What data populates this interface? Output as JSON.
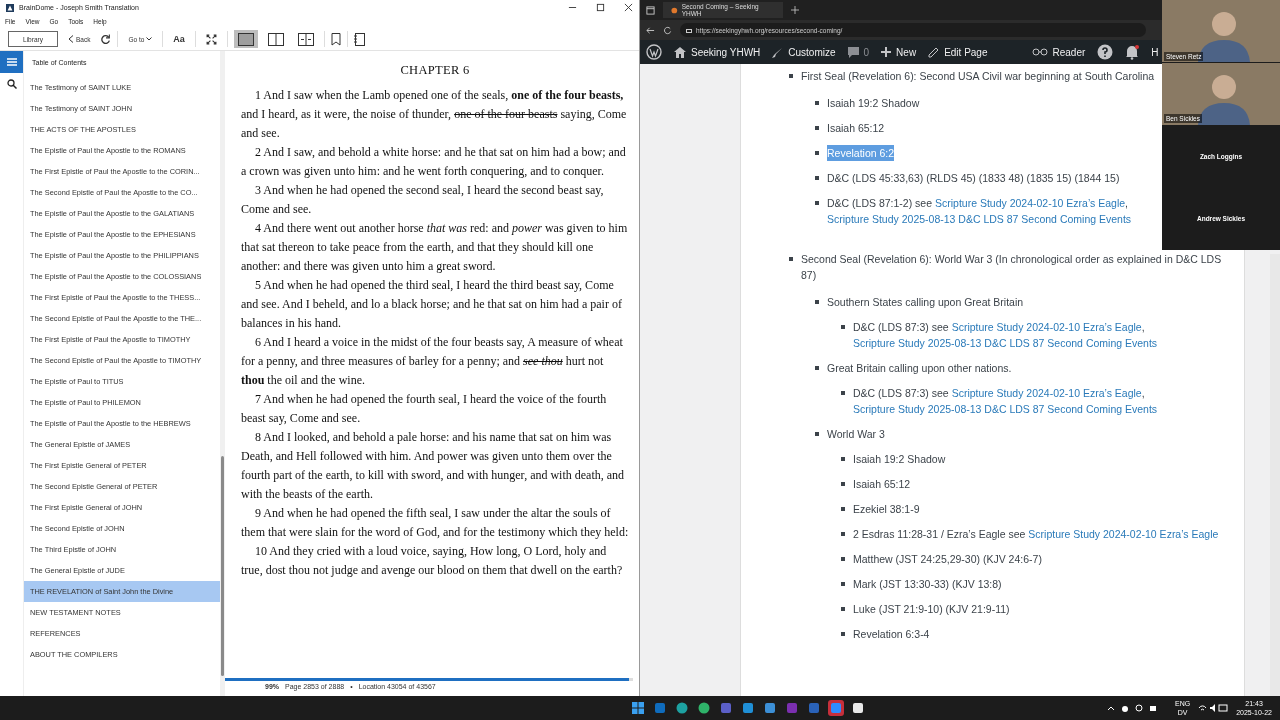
{
  "reader": {
    "window": {
      "title": "BrainDome - Joseph Smith Translation"
    },
    "menu": [
      "File",
      "View",
      "Go",
      "Tools",
      "Help"
    ],
    "toolbar": {
      "library": "Library",
      "back": "Back",
      "goto": "Go to",
      "font": "Aa",
      "views": [
        {
          "kind": "single",
          "selected": true
        },
        {
          "kind": "double",
          "selected": false
        },
        {
          "kind": "spread",
          "selected": false
        }
      ]
    },
    "sidebar": {
      "tabs": [
        {
          "kind": "toc",
          "selected": true
        },
        {
          "kind": "search",
          "selected": false
        }
      ],
      "title": "Table of Contents",
      "items": [
        {
          "label": "The Testimony of SAINT LUKE",
          "selected": false
        },
        {
          "label": "The Testimony of SAINT JOHN",
          "selected": false
        },
        {
          "label": "THE ACTS OF THE APOSTLES",
          "selected": false
        },
        {
          "label": "The Epistle of Paul the Apostle to the ROMANS",
          "selected": false
        },
        {
          "label": "The First Epistle of Paul the Apostle to the CORIN...",
          "selected": false
        },
        {
          "label": "The Second Epistle of Paul the Apostle to the CO...",
          "selected": false
        },
        {
          "label": "The Epistle of Paul the Apostle to the GALATIANS",
          "selected": false
        },
        {
          "label": "The Epistle of Paul the Apostle to the EPHESIANS",
          "selected": false
        },
        {
          "label": "The Epistle of Paul the Apostle to the PHILIPPIANS",
          "selected": false
        },
        {
          "label": "The Epistle of Paul the Apostle to the COLOSSIANS",
          "selected": false
        },
        {
          "label": "The First Epistle of Paul the Apostle to the THESS...",
          "selected": false
        },
        {
          "label": "The Second Epistle of Paul the Apostle to the THE...",
          "selected": false
        },
        {
          "label": "The First Epistle of Paul the Apostle to TIMOTHY",
          "selected": false
        },
        {
          "label": "The Second Epistle of Paul the Apostle to TIMOTHY",
          "selected": false
        },
        {
          "label": "The Epistle of Paul to TITUS",
          "selected": false
        },
        {
          "label": "The Epistle of Paul to PHILEMON",
          "selected": false
        },
        {
          "label": "The Epistle of Paul the Apostle to the HEBREWS",
          "selected": false
        },
        {
          "label": "The General Epistle of JAMES",
          "selected": false
        },
        {
          "label": "The First Epistle General of PETER",
          "selected": false
        },
        {
          "label": "The Second Epistle General of PETER",
          "selected": false
        },
        {
          "label": "The First Epistle General of JOHN",
          "selected": false
        },
        {
          "label": "The Second Epistle of JOHN",
          "selected": false
        },
        {
          "label": "The Third Epistle of JOHN",
          "selected": false
        },
        {
          "label": "The General Epistle of JUDE",
          "selected": false
        },
        {
          "label": "THE REVELATION of Saint John the Divine",
          "selected": true
        },
        {
          "label": "NEW TESTAMENT NOTES",
          "selected": false
        },
        {
          "label": "REFERENCES",
          "selected": false
        },
        {
          "label": "ABOUT THE COMPILERS",
          "selected": false
        }
      ]
    },
    "chapter": {
      "title": "CHAPTER 6",
      "verses": [
        [
          {
            "kind": "plain",
            "text": "1 And I saw when the Lamb opened one of the seals, "
          },
          {
            "kind": "bold",
            "text": "one of the four beasts,"
          },
          {
            "kind": "plain",
            "text": " and I heard, as it were, the noise of thunder, "
          },
          {
            "kind": "struck",
            "text": "one of the four beasts"
          },
          {
            "kind": "plain",
            "text": " saying, Come and see."
          }
        ],
        [
          {
            "kind": "plain",
            "text": "2 And I saw, and behold a white horse: and he that sat on him had a bow; and a crown was given unto him: and he went forth conquering, and to conquer."
          }
        ],
        [
          {
            "kind": "plain",
            "text": "3 And when he had opened the second seal, I heard the second beast say, Come and see."
          }
        ],
        [
          {
            "kind": "plain",
            "text": "4 And there went out another horse "
          },
          {
            "kind": "italic",
            "text": "that was"
          },
          {
            "kind": "plain",
            "text": " red: and "
          },
          {
            "kind": "italic",
            "text": "power"
          },
          {
            "kind": "plain",
            "text": " was given to him that sat thereon to take peace from the earth, and that they should kill one another: and there was given unto him a great sword."
          }
        ],
        [
          {
            "kind": "plain",
            "text": "5 And when he had opened the third seal, I heard the third beast say, Come and see. And I beheld, and lo a black horse; and he that sat on him had a pair of balances in his hand."
          }
        ],
        [
          {
            "kind": "plain",
            "text": "6 And I heard a voice in the midst of the four beasts say, A measure of wheat for a penny, and three measures of barley for a penny; and "
          },
          {
            "kind": "struck_italic",
            "text": "see thou"
          },
          {
            "kind": "plain",
            "text": " hurt not "
          },
          {
            "kind": "bold",
            "text": "thou"
          },
          {
            "kind": "plain",
            "text": " the oil and the wine."
          }
        ],
        [
          {
            "kind": "plain",
            "text": "7 And when he had opened the fourth seal, I heard the voice of the fourth beast say, Come and see."
          }
        ],
        [
          {
            "kind": "plain",
            "text": "8 And I looked, and behold a pale horse: and his name that sat on him was Death, and Hell followed with him. And power was given unto them over the fourth part of the earth, to kill with sword, and with hunger, and with death, and with the beasts of the earth."
          }
        ],
        [
          {
            "kind": "plain",
            "text": "9 And when he had opened the fifth seal, I saw under the altar the souls of them that were slain for the word of God, and for the testimony which they held:"
          }
        ],
        [
          {
            "kind": "plain",
            "text": "10 And they cried with a loud voice, saying, How long, O Lord, holy and true, dost thou not judge and avenge our blood on them that dwell on the earth?"
          }
        ]
      ]
    },
    "status": {
      "percent": "99%",
      "page": "Page 2853 of 2888",
      "separator": "•",
      "location": "Location 43054 of 43567",
      "level": 0.99
    }
  },
  "browser": {
    "tab": "Second Coming – Seeking YHWH",
    "url": "https://seekingyhwh.org/resources/second-coming/",
    "admin_bar": {
      "site": "Seeking YHWH",
      "customize": "Customize",
      "comments": "0",
      "new": "New",
      "edit": "Edit Page",
      "reader": "Reader",
      "cut_item": "H"
    },
    "outline": [
      {
        "highlighted": false,
        "segments": [
          {
            "kind": "text",
            "text": "First Seal (Revelation 6): Second USA Civil war beginning at South Carolina"
          }
        ],
        "children": [
          {
            "highlighted": false,
            "segments": [
              {
                "kind": "text",
                "text": "Isaiah 19:2 Shadow"
              }
            ]
          },
          {
            "highlighted": false,
            "segments": [
              {
                "kind": "text",
                "text": "Isaiah 65:12"
              }
            ]
          },
          {
            "highlighted": true,
            "segments": [
              {
                "kind": "text",
                "text": "Revelation 6:2"
              }
            ]
          },
          {
            "highlighted": false,
            "segments": [
              {
                "kind": "text",
                "text": "D&C (LDS 45:33,63) (RLDS 45) (1833 48) (1835 15) (1844 15)"
              }
            ]
          },
          {
            "highlighted": false,
            "segments": [
              {
                "kind": "text",
                "text": "D&C (LDS 87:1-2) see "
              },
              {
                "kind": "link",
                "text": "Scripture Study 2024-02-10 Ezra’s Eagle"
              },
              {
                "kind": "text",
                "text": ", "
              },
              {
                "kind": "link",
                "text": "Scripture Study 2025-08-13 D&C LDS 87 Second Coming Events"
              }
            ]
          }
        ]
      },
      {
        "highlighted": false,
        "segments": [
          {
            "kind": "text",
            "text": "Second Seal (Revelation 6): World War 3 (In chronological order as explained in D&C LDS 87)"
          }
        ],
        "children": [
          {
            "highlighted": false,
            "segments": [
              {
                "kind": "text",
                "text": "Southern States calling upon Great Britain"
              }
            ],
            "children": [
              {
                "highlighted": false,
                "segments": [
                  {
                    "kind": "text",
                    "text": "D&C (LDS 87:3) see "
                  },
                  {
                    "kind": "link",
                    "text": "Scripture Study 2024-02-10 Ezra’s Eagle"
                  },
                  {
                    "kind": "text",
                    "text": ", "
                  },
                  {
                    "kind": "link",
                    "text": "Scripture Study 2025-08-13 D&C LDS 87 Second Coming Events"
                  }
                ]
              }
            ]
          },
          {
            "highlighted": false,
            "segments": [
              {
                "kind": "text",
                "text": "Great Britain calling upon other nations."
              }
            ],
            "children": [
              {
                "highlighted": false,
                "segments": [
                  {
                    "kind": "text",
                    "text": "D&C (LDS 87:3) see "
                  },
                  {
                    "kind": "link",
                    "text": "Scripture Study 2024-02-10 Ezra’s Eagle"
                  },
                  {
                    "kind": "text",
                    "text": ", "
                  },
                  {
                    "kind": "link",
                    "text": "Scripture Study 2025-08-13 D&C LDS 87 Second Coming Events"
                  }
                ]
              }
            ]
          },
          {
            "highlighted": false,
            "segments": [
              {
                "kind": "text",
                "text": "World War 3"
              }
            ],
            "children": [
              {
                "highlighted": false,
                "segments": [
                  {
                    "kind": "text",
                    "text": "Isaiah 19:2 Shadow"
                  }
                ]
              },
              {
                "highlighted": false,
                "segments": [
                  {
                    "kind": "text",
                    "text": "Isaiah 65:12"
                  }
                ]
              },
              {
                "highlighted": false,
                "segments": [
                  {
                    "kind": "text",
                    "text": "Ezekiel 38:1-9"
                  }
                ]
              },
              {
                "highlighted": false,
                "segments": [
                  {
                    "kind": "text",
                    "text": "2 Esdras 11:28-31 / Ezra’s Eagle see "
                  },
                  {
                    "kind": "link",
                    "text": "Scripture Study 2024-02-10 Ezra’s Eagle"
                  }
                ]
              },
              {
                "highlighted": false,
                "segments": [
                  {
                    "kind": "text",
                    "text": "Matthew (JST 24:25,29-30) (KJV 24:6-7)"
                  }
                ]
              },
              {
                "highlighted": false,
                "segments": [
                  {
                    "kind": "text",
                    "text": "Mark (JST 13:30-33) (KJV 13:8)"
                  }
                ]
              },
              {
                "highlighted": false,
                "segments": [
                  {
                    "kind": "text",
                    "text": "Luke (JST 21:9-10) (KJV 21:9-11)"
                  }
                ]
              },
              {
                "highlighted": false,
                "segments": [
                  {
                    "kind": "text",
                    "text": "Revelation 6:3-4"
                  }
                ]
              }
            ]
          }
        ]
      }
    ]
  },
  "call": {
    "participants": [
      {
        "name": "Steven Retz",
        "kind": "video"
      },
      {
        "name": "Ben Sickles",
        "kind": "video"
      },
      {
        "name": "Zach Loggins",
        "kind": "audio"
      },
      {
        "name": "Andrew Sickles",
        "kind": "audio"
      }
    ]
  },
  "taskbar": {
    "apps": [
      {
        "kind": "start",
        "active": false
      },
      {
        "kind": "mail",
        "active": false
      },
      {
        "kind": "browser",
        "active": false
      },
      {
        "kind": "browser_dev",
        "active": false
      },
      {
        "kind": "writer",
        "active": false
      },
      {
        "kind": "chart",
        "active": false
      },
      {
        "kind": "notes",
        "active": false
      },
      {
        "kind": "onenote",
        "active": false
      },
      {
        "kind": "upload",
        "active": false
      },
      {
        "kind": "meeting",
        "active": true
      },
      {
        "kind": "reader",
        "active": false
      }
    ],
    "language": "ENG",
    "layout": "DV",
    "time": "21:43",
    "date": "2025-10-22"
  }
}
